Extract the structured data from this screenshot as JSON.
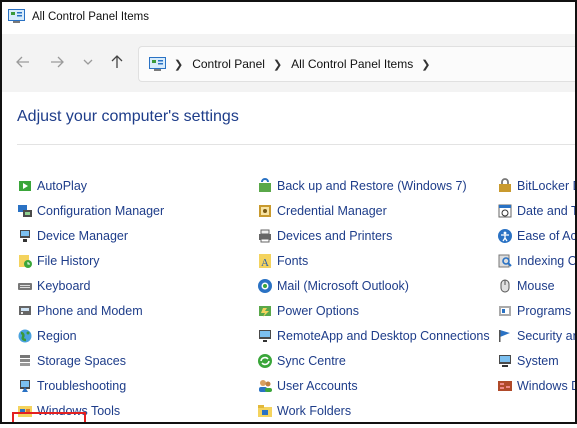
{
  "window": {
    "title": "All Control Panel Items"
  },
  "nav": {
    "back": "back-arrow",
    "forward": "forward-arrow",
    "recent": "chevron-down",
    "up": "up-arrow",
    "breadcrumb": [
      "Control Panel",
      "All Control Panel Items"
    ]
  },
  "page": {
    "heading": "Adjust your computer's settings"
  },
  "columns": [
    [
      {
        "label": "AutoPlay",
        "icon": "autoplay-icon"
      },
      {
        "label": "Configuration Manager",
        "icon": "configuration-manager-icon"
      },
      {
        "label": "Device Manager",
        "icon": "device-manager-icon"
      },
      {
        "label": "File History",
        "icon": "file-history-icon"
      },
      {
        "label": "Keyboard",
        "icon": "keyboard-icon"
      },
      {
        "label": "Phone and Modem",
        "icon": "phone-modem-icon"
      },
      {
        "label": "Region",
        "icon": "region-icon"
      },
      {
        "label": "Storage Spaces",
        "icon": "storage-spaces-icon"
      },
      {
        "label": "Troubleshooting",
        "icon": "troubleshooting-icon"
      },
      {
        "label": "Windows Tools",
        "icon": "windows-tools-icon"
      }
    ],
    [
      {
        "label": "Back up and Restore (Windows 7)",
        "icon": "backup-restore-icon"
      },
      {
        "label": "Credential Manager",
        "icon": "credential-manager-icon"
      },
      {
        "label": "Devices and Printers",
        "icon": "devices-printers-icon"
      },
      {
        "label": "Fonts",
        "icon": "fonts-icon"
      },
      {
        "label": "Mail (Microsoft Outlook)",
        "icon": "mail-icon"
      },
      {
        "label": "Power Options",
        "icon": "power-options-icon"
      },
      {
        "label": "RemoteApp and Desktop Connections",
        "icon": "remoteapp-icon"
      },
      {
        "label": "Sync Centre",
        "icon": "sync-centre-icon"
      },
      {
        "label": "User Accounts",
        "icon": "user-accounts-icon"
      },
      {
        "label": "Work Folders",
        "icon": "work-folders-icon"
      }
    ],
    [
      {
        "label": "BitLocker D",
        "icon": "bitlocker-icon"
      },
      {
        "label": "Date and T",
        "icon": "date-time-icon"
      },
      {
        "label": "Ease of Ac",
        "icon": "ease-of-access-icon"
      },
      {
        "label": "Indexing C",
        "icon": "indexing-icon"
      },
      {
        "label": "Mouse",
        "icon": "mouse-icon"
      },
      {
        "label": "Programs",
        "icon": "programs-icon"
      },
      {
        "label": "Security ar",
        "icon": "security-icon"
      },
      {
        "label": "System",
        "icon": "system-icon"
      },
      {
        "label": "Windows D",
        "icon": "windows-defender-icon"
      },
      {
        "label": "",
        "icon": ""
      }
    ]
  ],
  "highlighted_item": "Region",
  "colors": {
    "link": "#1e3d8a",
    "highlight": "#e32020",
    "navbar": "#f3f3f3"
  }
}
